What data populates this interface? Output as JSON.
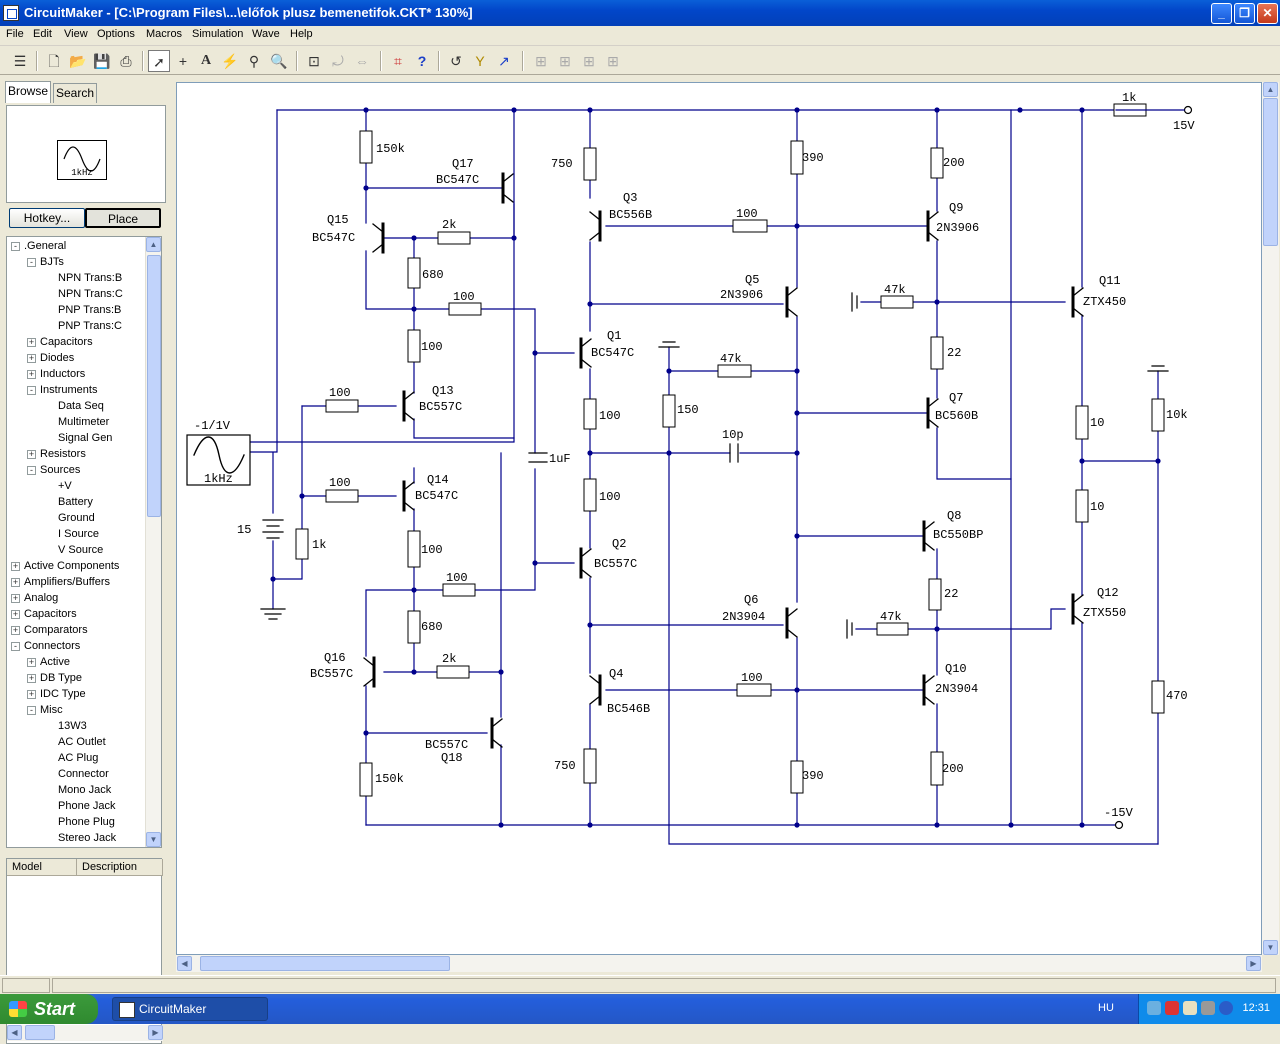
{
  "window": {
    "title": "CircuitMaker - [C:\\Program Files\\...\\előfok plusz bemenetifok.CKT* 130%]"
  },
  "menu": [
    "File",
    "Edit",
    "View",
    "Options",
    "Macros",
    "Simulation",
    "Wave",
    "Help"
  ],
  "toolbar_icons": [
    "stack-icon",
    "new-file-icon",
    "open-folder-icon",
    "save-icon",
    "print-icon",
    "arrow-pointer-icon",
    "wire-cross-icon",
    "text-tool-icon",
    "probe-lightning-icon",
    "wand-icon",
    "magnifier-icon",
    "zoom-fit-icon",
    "rotate-icon",
    "mirror-icon",
    "digital-sim-icon",
    "help-icon",
    "undo-icon",
    "fault-icon",
    "trace-icon",
    "align-left-icon",
    "align-top-icon",
    "align-right-icon",
    "align-bottom-icon"
  ],
  "left_panel": {
    "tabs": [
      "Browse",
      "Search"
    ],
    "preview_label": "1kHz",
    "buttons": {
      "hotkey": "Hotkey...",
      "place": "Place"
    },
    "tree": [
      {
        "label": ".General",
        "level": 0,
        "expand": "-"
      },
      {
        "label": "BJTs",
        "level": 1,
        "expand": "-"
      },
      {
        "label": "NPN Trans:B",
        "level": 2,
        "expand": ""
      },
      {
        "label": "NPN Trans:C",
        "level": 2,
        "expand": ""
      },
      {
        "label": "PNP Trans:B",
        "level": 2,
        "expand": ""
      },
      {
        "label": "PNP Trans:C",
        "level": 2,
        "expand": ""
      },
      {
        "label": "Capacitors",
        "level": 1,
        "expand": "+"
      },
      {
        "label": "Diodes",
        "level": 1,
        "expand": "+"
      },
      {
        "label": "Inductors",
        "level": 1,
        "expand": "+"
      },
      {
        "label": "Instruments",
        "level": 1,
        "expand": "-"
      },
      {
        "label": "Data Seq",
        "level": 2,
        "expand": ""
      },
      {
        "label": "Multimeter",
        "level": 2,
        "expand": ""
      },
      {
        "label": "Signal Gen",
        "level": 2,
        "expand": ""
      },
      {
        "label": "Resistors",
        "level": 1,
        "expand": "+"
      },
      {
        "label": "Sources",
        "level": 1,
        "expand": "-"
      },
      {
        "label": "+V",
        "level": 2,
        "expand": ""
      },
      {
        "label": "Battery",
        "level": 2,
        "expand": ""
      },
      {
        "label": "Ground",
        "level": 2,
        "expand": ""
      },
      {
        "label": "I Source",
        "level": 2,
        "expand": ""
      },
      {
        "label": "V Source",
        "level": 2,
        "expand": ""
      },
      {
        "label": "Active Components",
        "level": 0,
        "expand": "+"
      },
      {
        "label": "Amplifiers/Buffers",
        "level": 0,
        "expand": "+"
      },
      {
        "label": "Analog",
        "level": 0,
        "expand": "+"
      },
      {
        "label": "Capacitors",
        "level": 0,
        "expand": "+"
      },
      {
        "label": "Comparators",
        "level": 0,
        "expand": "+"
      },
      {
        "label": "Connectors",
        "level": 0,
        "expand": "-"
      },
      {
        "label": "Active",
        "level": 1,
        "expand": "+"
      },
      {
        "label": "DB Type",
        "level": 1,
        "expand": "+"
      },
      {
        "label": "IDC Type",
        "level": 1,
        "expand": "+"
      },
      {
        "label": "Misc",
        "level": 1,
        "expand": "-"
      },
      {
        "label": "13W3",
        "level": 2,
        "expand": ""
      },
      {
        "label": "AC Outlet",
        "level": 2,
        "expand": ""
      },
      {
        "label": "AC Plug",
        "level": 2,
        "expand": ""
      },
      {
        "label": "Connector",
        "level": 2,
        "expand": ""
      },
      {
        "label": "Mono Jack",
        "level": 2,
        "expand": ""
      },
      {
        "label": "Phone Jack",
        "level": 2,
        "expand": ""
      },
      {
        "label": "Phone Plug",
        "level": 2,
        "expand": ""
      },
      {
        "label": "Stereo Jack",
        "level": 2,
        "expand": ""
      }
    ],
    "model_columns": [
      "Model",
      "Description"
    ]
  },
  "schematic": {
    "labels": [
      {
        "t": "150k"
      },
      {
        "t": "Q17"
      },
      {
        "t": "BC547C"
      },
      {
        "t": "Q15"
      },
      {
        "t": "BC547C"
      },
      {
        "t": "2k"
      },
      {
        "t": "680"
      },
      {
        "t": "100"
      },
      {
        "t": "100"
      },
      {
        "t": "100"
      },
      {
        "t": "Q13"
      },
      {
        "t": "BC557C"
      },
      {
        "t": "100"
      },
      {
        "t": "Q14"
      },
      {
        "t": "BC547C"
      },
      {
        "t": "1k"
      },
      {
        "t": "100"
      },
      {
        "t": "100"
      },
      {
        "t": "680"
      },
      {
        "t": "Q16"
      },
      {
        "t": "BC557C"
      },
      {
        "t": "2k"
      },
      {
        "t": "BC557C"
      },
      {
        "t": "Q18"
      },
      {
        "t": "150k"
      },
      {
        "t": "-1/1V"
      },
      {
        "t": "1kHz"
      },
      {
        "t": "15"
      },
      {
        "t": "750"
      },
      {
        "t": "Q3"
      },
      {
        "t": "BC556B"
      },
      {
        "t": "Q1"
      },
      {
        "t": "BC547C"
      },
      {
        "t": "100"
      },
      {
        "t": "1uF"
      },
      {
        "t": "100"
      },
      {
        "t": "Q2"
      },
      {
        "t": "BC557C"
      },
      {
        "t": "Q4"
      },
      {
        "t": "BC546B"
      },
      {
        "t": "750"
      },
      {
        "t": "100"
      },
      {
        "t": "390"
      },
      {
        "t": "Q5"
      },
      {
        "t": "2N3906"
      },
      {
        "t": "47k"
      },
      {
        "t": "150"
      },
      {
        "t": "10p"
      },
      {
        "t": "Q6"
      },
      {
        "t": "2N3904"
      },
      {
        "t": "100"
      },
      {
        "t": "390"
      },
      {
        "t": "200"
      },
      {
        "t": "Q9"
      },
      {
        "t": "2N3906"
      },
      {
        "t": "47k"
      },
      {
        "t": "22"
      },
      {
        "t": "Q7"
      },
      {
        "t": "BC560B"
      },
      {
        "t": "Q8"
      },
      {
        "t": "BC550BP"
      },
      {
        "t": "22"
      },
      {
        "t": "47k"
      },
      {
        "t": "Q10"
      },
      {
        "t": "2N3904"
      },
      {
        "t": "200"
      },
      {
        "t": "1k"
      },
      {
        "t": "15V"
      },
      {
        "t": "Q11"
      },
      {
        "t": "ZTX450"
      },
      {
        "t": "10"
      },
      {
        "t": "10k"
      },
      {
        "t": "10"
      },
      {
        "t": "Q12"
      },
      {
        "t": "ZTX550"
      },
      {
        "t": "470"
      },
      {
        "t": "-15V"
      }
    ]
  },
  "taskbar": {
    "start": "Start",
    "task": "CircuitMaker",
    "lang": "HU",
    "clock": "12:31"
  }
}
